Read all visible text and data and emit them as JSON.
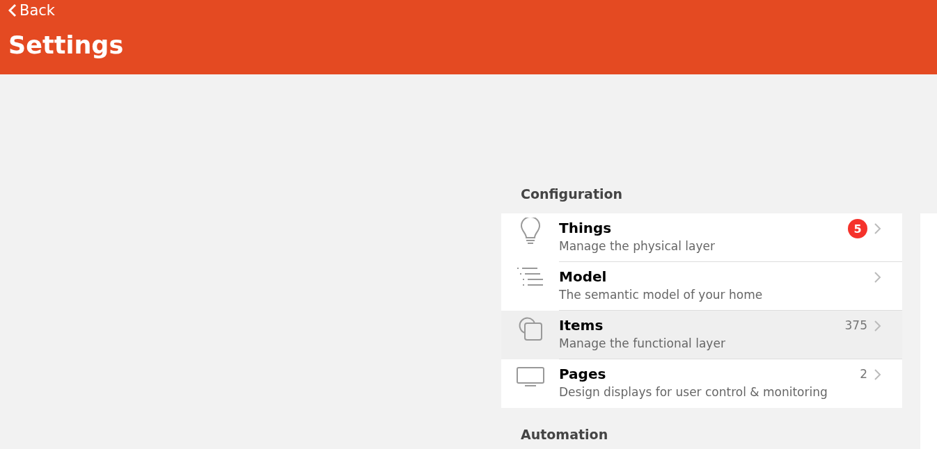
{
  "header": {
    "back": "Back",
    "title": "Settings"
  },
  "sections": [
    {
      "title": "Configuration",
      "items": [
        {
          "kind": "bulb",
          "title": "Things",
          "subtitle": "Manage the physical layer",
          "badge": "5",
          "highlighted": false
        },
        {
          "kind": "list",
          "title": "Model",
          "subtitle": "The semantic model of your home",
          "highlighted": false
        },
        {
          "kind": "squares",
          "title": "Items",
          "subtitle": "Manage the functional layer",
          "count": "375",
          "highlighted": true
        },
        {
          "kind": "monitor",
          "title": "Pages",
          "subtitle": "Design displays for user control & monitoring",
          "count": "2",
          "highlighted": false
        }
      ]
    },
    {
      "title": "Automation"
    }
  ]
}
